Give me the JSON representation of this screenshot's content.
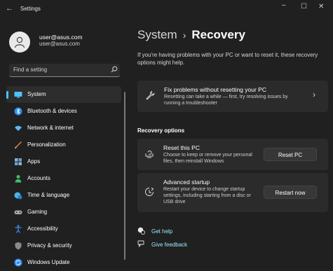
{
  "titlebar": {
    "back_glyph": "←",
    "app_title": "Settings",
    "min_glyph": "–",
    "max_glyph": "☐",
    "close_glyph": "✕"
  },
  "profile": {
    "name": "user@asus.com",
    "email": "user@asus.com"
  },
  "search": {
    "placeholder": "Find a setting",
    "value": ""
  },
  "nav": {
    "items": [
      {
        "label": "System",
        "icon": "monitor-icon",
        "color": "#4cc2ff",
        "active": true
      },
      {
        "label": "Bluetooth & devices",
        "icon": "bluetooth-icon",
        "color": "#2e8ff0"
      },
      {
        "label": "Network & internet",
        "icon": "wifi-icon",
        "color": "#5fb9f7"
      },
      {
        "label": "Personalization",
        "icon": "brush-icon",
        "color": "#e8834b"
      },
      {
        "label": "Apps",
        "icon": "apps-icon",
        "color": "#8ab3d6"
      },
      {
        "label": "Accounts",
        "icon": "person-icon",
        "color": "#3fbf6e"
      },
      {
        "label": "Time & language",
        "icon": "globe-clock-icon",
        "color": "#4cb3f0"
      },
      {
        "label": "Gaming",
        "icon": "gamepad-icon",
        "color": "#a9a9a9"
      },
      {
        "label": "Accessibility",
        "icon": "accessibility-icon",
        "color": "#3d8df0"
      },
      {
        "label": "Privacy & security",
        "icon": "shield-icon",
        "color": "#8a8a8a"
      },
      {
        "label": "Windows Update",
        "icon": "update-icon",
        "color": "#2f8ff0"
      }
    ]
  },
  "main": {
    "breadcrumb_root": "System",
    "breadcrumb_sep": "›",
    "title": "Recovery",
    "description": "If you're having problems with your PC or want to reset it, these recovery options might help.",
    "fix_card": {
      "title": "Fix problems without resetting your PC",
      "subtitle": "Resetting can take a while — first, try resolving issues by running a troubleshooter",
      "chevron": "›"
    },
    "section_heading": "Recovery options",
    "reset_card": {
      "title": "Reset this PC",
      "subtitle": "Choose to keep or remove your personal files, then reinstall Windows",
      "button": "Reset PC"
    },
    "advanced_card": {
      "title": "Advanced startup",
      "subtitle": "Restart your device to change startup settings, including starting from a disc or USB drive",
      "button": "Restart now"
    },
    "links": {
      "help": "Get help",
      "feedback": "Give feedback"
    }
  },
  "colors": {
    "accent": "#4cc2ff",
    "link": "#99ebff",
    "background": "#202020",
    "card": "#2b2b2b"
  }
}
